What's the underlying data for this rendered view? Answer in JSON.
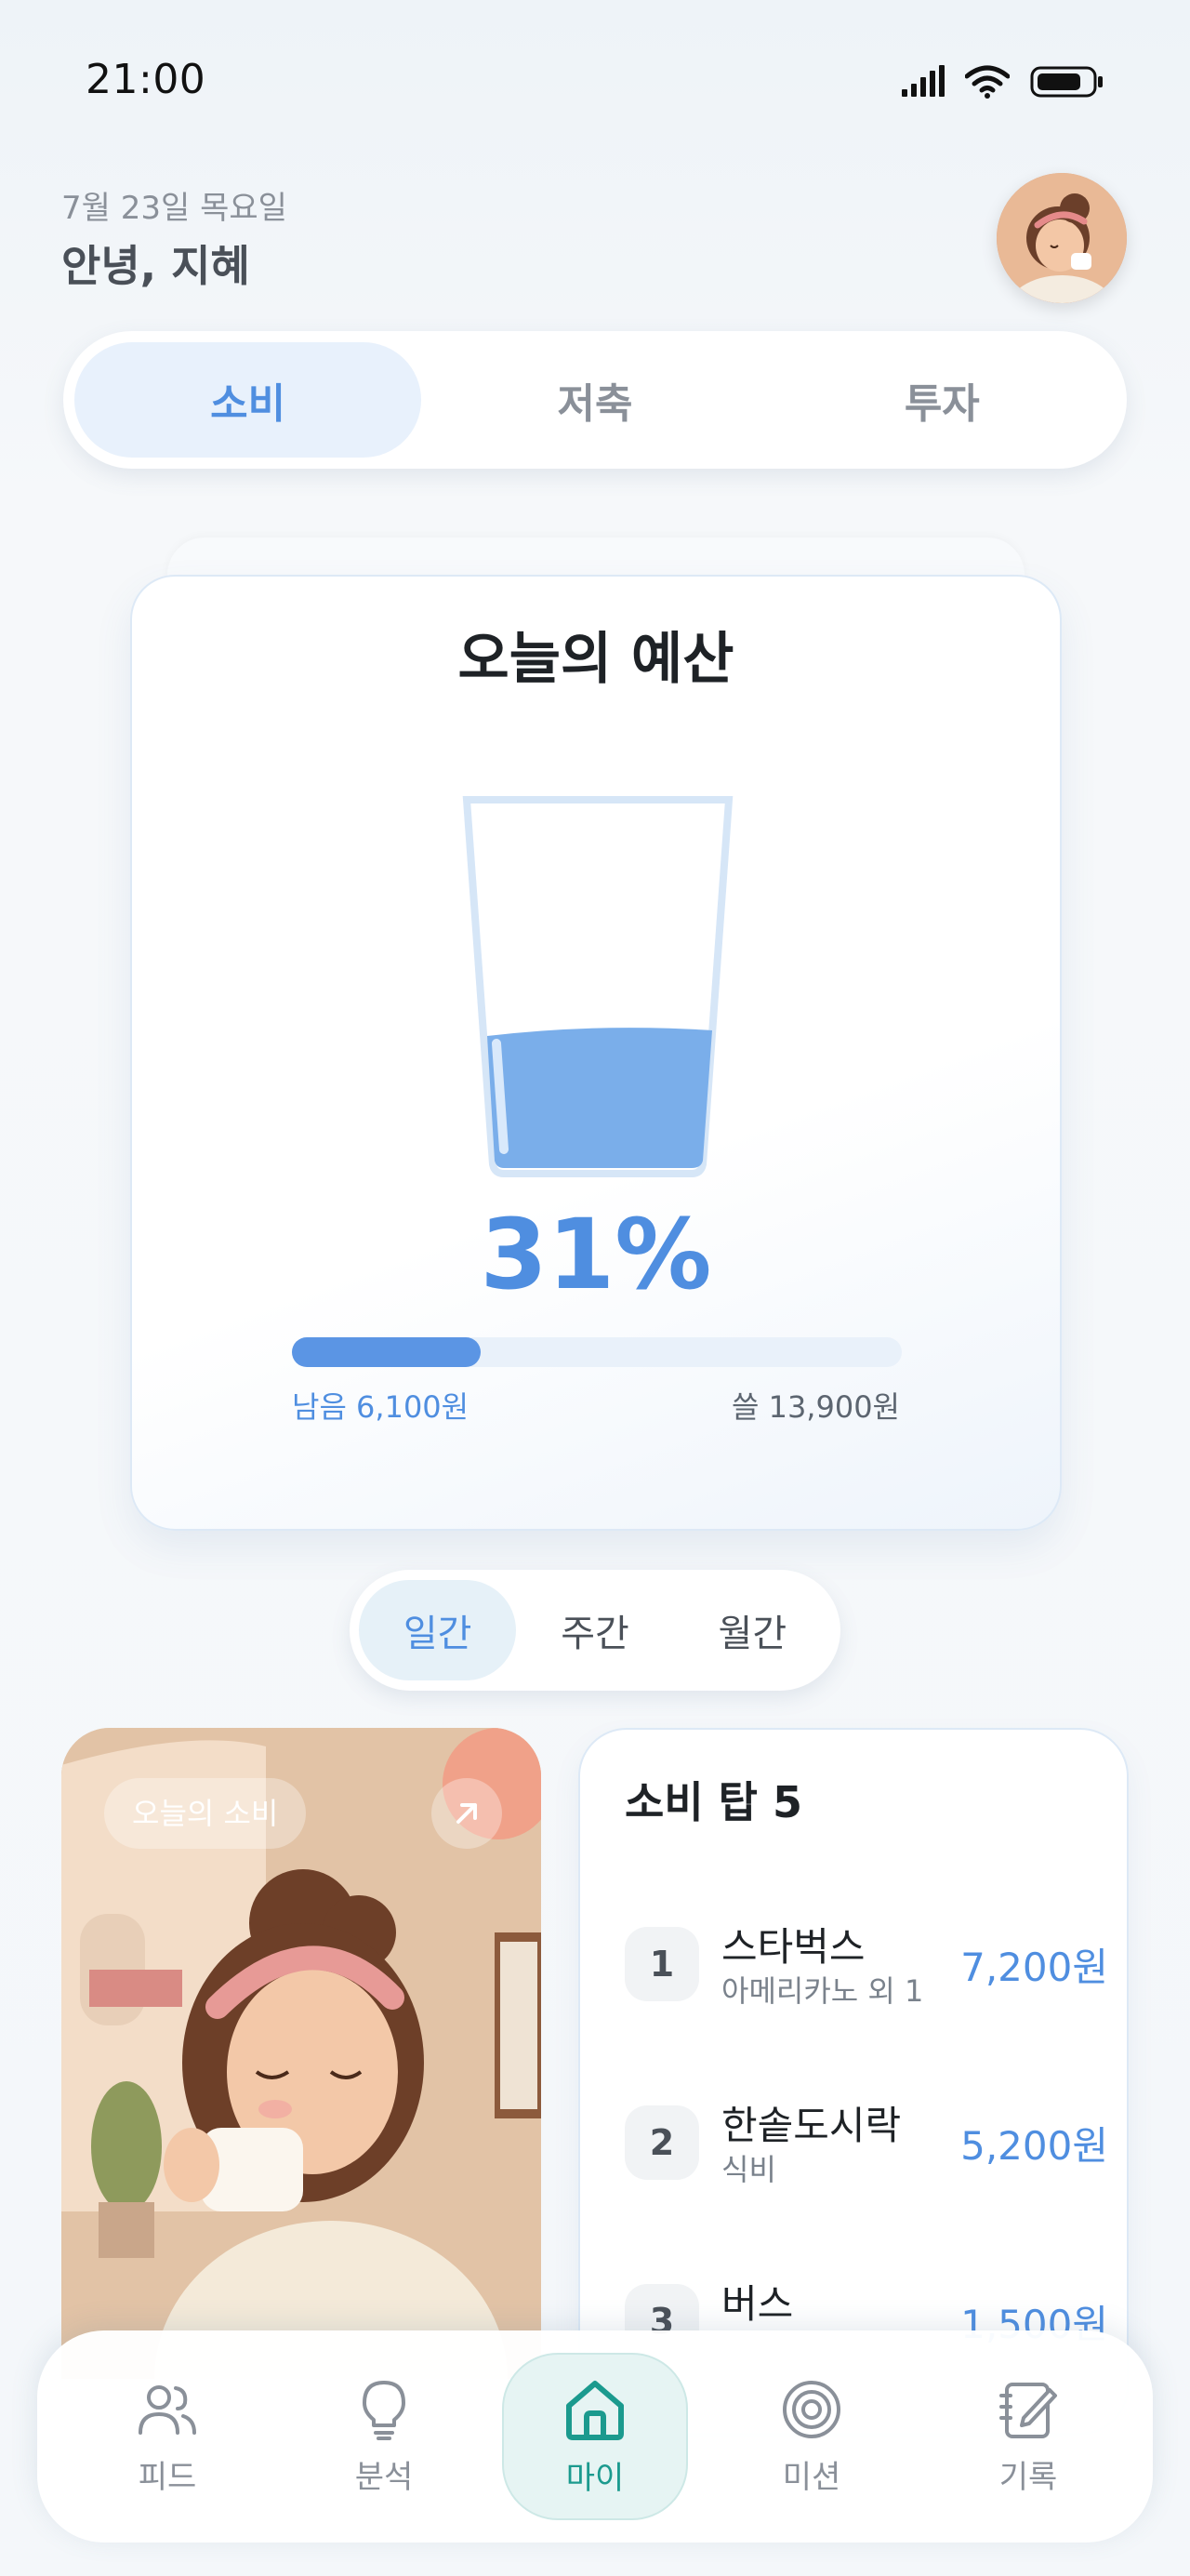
{
  "status_bar": {
    "time": "21:00"
  },
  "header": {
    "date": "7월 23일 목요일",
    "greeting": "안녕, 지혜"
  },
  "tabs": [
    {
      "label": "소비",
      "active": true
    },
    {
      "label": "저축",
      "active": false
    },
    {
      "label": "투자",
      "active": false
    }
  ],
  "budget": {
    "title": "오늘의 예산",
    "percent_text": "31%",
    "progress_fraction": 0.31,
    "remaining": "남음 6,100원",
    "spent": "쓸 13,900원"
  },
  "period": [
    {
      "label": "일간",
      "active": true
    },
    {
      "label": "주간",
      "active": false
    },
    {
      "label": "월간",
      "active": false
    }
  ],
  "photo_card": {
    "label": "오늘의 소비"
  },
  "top5": {
    "title": "소비 탑 5",
    "items": [
      {
        "rank": "1",
        "name": "스타벅스",
        "sub": "아메리카노 외 1",
        "amount": "7,200원"
      },
      {
        "rank": "2",
        "name": "한솥도시락",
        "sub": "식비",
        "amount": "5,200원"
      },
      {
        "rank": "3",
        "name": "버스",
        "sub": "",
        "amount": "1,500원"
      }
    ]
  },
  "nav": [
    {
      "label": "피드",
      "icon": "users-icon",
      "active": false
    },
    {
      "label": "분석",
      "icon": "lightbulb-icon",
      "active": false
    },
    {
      "label": "마이",
      "icon": "home-icon",
      "active": true
    },
    {
      "label": "미션",
      "icon": "target-icon",
      "active": false
    },
    {
      "label": "기록",
      "icon": "notebook-edit-icon",
      "active": false
    }
  ],
  "colors": {
    "accent_blue": "#4f8ee0",
    "accent_teal": "#1b9a8e",
    "water": "#7aaeea"
  }
}
